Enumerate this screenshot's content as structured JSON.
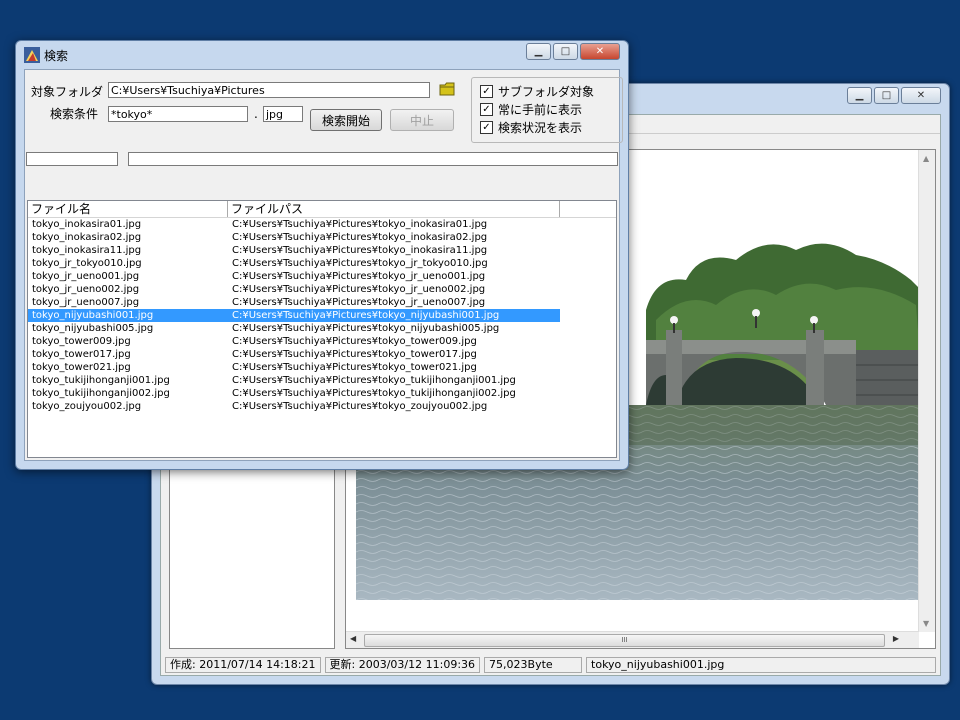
{
  "viewer": {
    "status": {
      "created": "作成: 2011/07/14 14:18:21",
      "updated": "更新: 2003/03/12 11:09:36",
      "size": "75,023Byte",
      "filename": "tokyo_nijyubashi001.jpg"
    },
    "scroll_grip": "III"
  },
  "dialog": {
    "title": "検索",
    "target_folder_label": "対象フォルダ",
    "target_folder_value": "C:¥Users¥Tsuchiya¥Pictures",
    "condition_label": "検索条件",
    "condition_value": "*tokyo*",
    "dot": ".",
    "extension_value": "jpg",
    "start_button": "検索開始",
    "stop_button": "中止",
    "options": [
      {
        "label": "サブフォルダ対象",
        "checked": true
      },
      {
        "label": "常に手前に表示",
        "checked": true
      },
      {
        "label": "検索状況を表示",
        "checked": true
      }
    ],
    "columns": [
      "ファイル名",
      "ファイルパス"
    ],
    "rows": [
      {
        "name": "tokyo_inokasira01.jpg",
        "path": "C:¥Users¥Tsuchiya¥Pictures¥tokyo_inokasira01.jpg"
      },
      {
        "name": "tokyo_inokasira02.jpg",
        "path": "C:¥Users¥Tsuchiya¥Pictures¥tokyo_inokasira02.jpg"
      },
      {
        "name": "tokyo_inokasira11.jpg",
        "path": "C:¥Users¥Tsuchiya¥Pictures¥tokyo_inokasira11.jpg"
      },
      {
        "name": "tokyo_jr_tokyo010.jpg",
        "path": "C:¥Users¥Tsuchiya¥Pictures¥tokyo_jr_tokyo010.jpg"
      },
      {
        "name": "tokyo_jr_ueno001.jpg",
        "path": "C:¥Users¥Tsuchiya¥Pictures¥tokyo_jr_ueno001.jpg"
      },
      {
        "name": "tokyo_jr_ueno002.jpg",
        "path": "C:¥Users¥Tsuchiya¥Pictures¥tokyo_jr_ueno002.jpg"
      },
      {
        "name": "tokyo_jr_ueno007.jpg",
        "path": "C:¥Users¥Tsuchiya¥Pictures¥tokyo_jr_ueno007.jpg"
      },
      {
        "name": "tokyo_nijyubashi001.jpg",
        "path": "C:¥Users¥Tsuchiya¥Pictures¥tokyo_nijyubashi001.jpg",
        "selected": true
      },
      {
        "name": "tokyo_nijyubashi005.jpg",
        "path": "C:¥Users¥Tsuchiya¥Pictures¥tokyo_nijyubashi005.jpg"
      },
      {
        "name": "tokyo_tower009.jpg",
        "path": "C:¥Users¥Tsuchiya¥Pictures¥tokyo_tower009.jpg"
      },
      {
        "name": "tokyo_tower017.jpg",
        "path": "C:¥Users¥Tsuchiya¥Pictures¥tokyo_tower017.jpg"
      },
      {
        "name": "tokyo_tower021.jpg",
        "path": "C:¥Users¥Tsuchiya¥Pictures¥tokyo_tower021.jpg"
      },
      {
        "name": "tokyo_tukijihonganji001.jpg",
        "path": "C:¥Users¥Tsuchiya¥Pictures¥tokyo_tukijihonganji001.jpg"
      },
      {
        "name": "tokyo_tukijihonganji002.jpg",
        "path": "C:¥Users¥Tsuchiya¥Pictures¥tokyo_tukijihonganji002.jpg"
      },
      {
        "name": "tokyo_zoujyou002.jpg",
        "path": "C:¥Users¥Tsuchiya¥Pictures¥tokyo_zoujyou002.jpg"
      }
    ]
  },
  "colors": {
    "desktop": "#0c3a72",
    "selection": "#3399ff",
    "folder_icon": "#d4c21a"
  },
  "icons": [
    "app-icon",
    "minimize-icon",
    "maximize-icon",
    "close-icon",
    "folder-icon",
    "check-icon",
    "scroll-up-icon",
    "scroll-down-icon",
    "scroll-left-icon",
    "scroll-right-icon"
  ]
}
